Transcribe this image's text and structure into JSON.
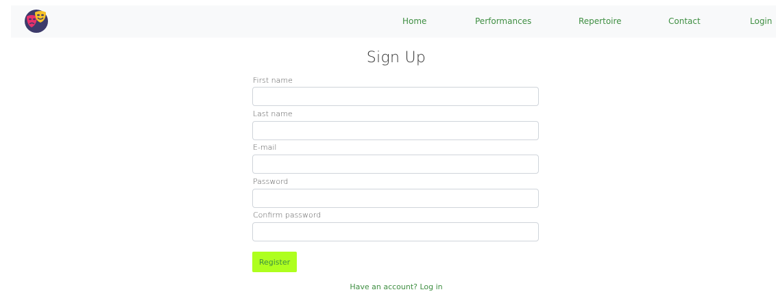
{
  "nav": {
    "logo_icon": "theater-masks-icon",
    "links": [
      "Home",
      "Performances",
      "Repertoire",
      "Contact",
      "Login"
    ]
  },
  "form": {
    "title": "Sign Up",
    "fields": [
      {
        "label": "First name",
        "value": "",
        "placeholder": ""
      },
      {
        "label": "Last name",
        "value": "",
        "placeholder": ""
      },
      {
        "label": "E-mail",
        "value": "",
        "placeholder": ""
      },
      {
        "label": "Password",
        "value": "",
        "placeholder": ""
      },
      {
        "label": "Confirm password",
        "value": "",
        "placeholder": ""
      }
    ],
    "submit_label": "Register",
    "login_prompt": "Have an account? Log in"
  },
  "colors": {
    "accent": "#aeff1e",
    "link": "#3e8e41",
    "navbar_bg": "#f8f9fa",
    "logo_circle": "#3d3b6b",
    "mask_pink": "#e8316b",
    "mask_yellow": "#f7c229"
  }
}
